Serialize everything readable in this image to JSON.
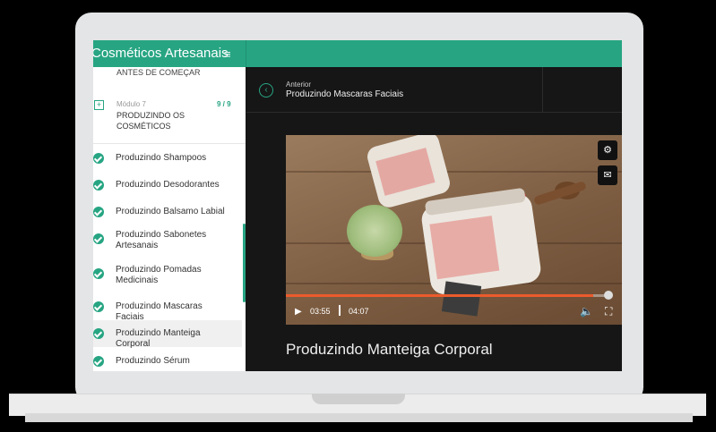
{
  "app": {
    "course_title": "Cosméticos Artesanais",
    "menu_icon": "menu-icon"
  },
  "sidebar": {
    "previous_module_label": "ANTES DE COMEÇAR",
    "module": {
      "number": "Módulo 7",
      "count": "9 / 9",
      "title": "PRODUZINDO OS COSMÉTICOS"
    },
    "lessons": [
      {
        "label": "Produzindo Shampoos"
      },
      {
        "label": "Produzindo Desodorantes"
      },
      {
        "label": "Produzindo Balsamo Labial"
      },
      {
        "label": "Produzindo Sabonetes Artesanais"
      },
      {
        "label": "Produzindo Pomadas Medicinais"
      },
      {
        "label": "Produzindo Mascaras Faciais"
      },
      {
        "label": "Produzindo Manteiga Corporal"
      },
      {
        "label": "Produzindo Sérum"
      }
    ]
  },
  "navigation": {
    "anterior_label": "Anterior",
    "previous_lesson": "Produzindo Mascaras Faciais"
  },
  "player": {
    "current_time": "03:55",
    "total_time": "04:07",
    "progress_fraction": 0.953,
    "accent_color": "#ec5b2d"
  },
  "main": {
    "lesson_title": "Produzindo Manteiga Corporal"
  },
  "colors": {
    "brand": "#27a583",
    "background": "#161616"
  }
}
